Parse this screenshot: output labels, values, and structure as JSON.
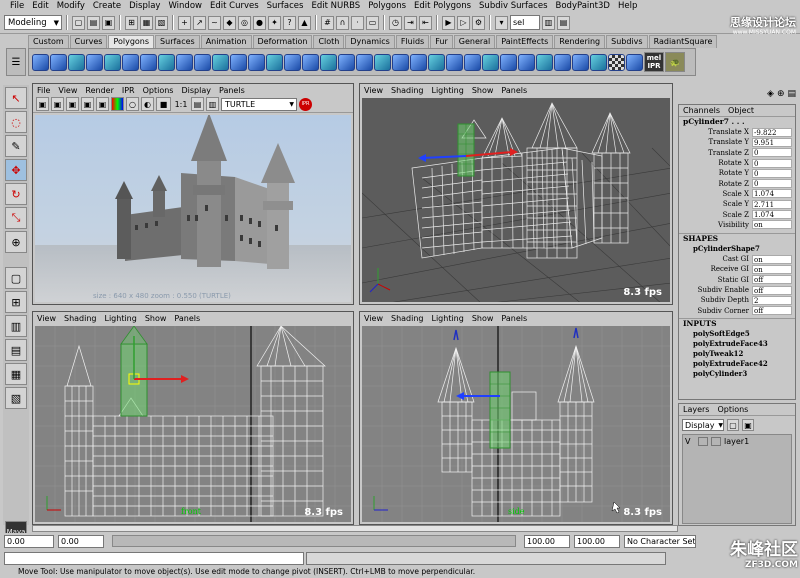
{
  "menubar": [
    "File",
    "Edit",
    "Modify",
    "Create",
    "Display",
    "Window",
    "Edit Curves",
    "Surfaces",
    "Edit NURBS",
    "Polygons",
    "Edit Polygons",
    "Subdiv Surfaces",
    "BodyPaint3D",
    "Help"
  ],
  "statusline": {
    "mode": "Modeling",
    "sel": "sel"
  },
  "shelf_tabs": [
    "Custom",
    "Curves",
    "Polygons",
    "Surfaces",
    "Animation",
    "Deformation",
    "Cloth",
    "Dynamics",
    "Fluids",
    "Fur",
    "General",
    "PaintEffects",
    "Rendering",
    "Subdivs",
    "RadiantSquare"
  ],
  "shelf_active": "Polygons",
  "shelf_mel": "mel",
  "shelf_ipr": "IPR",
  "render_view": {
    "menu": [
      "File",
      "View",
      "Render",
      "IPR",
      "Options",
      "Display",
      "Panels"
    ],
    "ratio": "1:1",
    "renderer": "TURTLE",
    "ipr_badge": "IPR",
    "caption": "size : 640 x 480  zoom : 0.550   (TURTLE)"
  },
  "persp_view": {
    "menu": [
      "View",
      "Shading",
      "Lighting",
      "Show",
      "Panels"
    ],
    "fps": "8.3 fps"
  },
  "front_view": {
    "menu": [
      "View",
      "Shading",
      "Lighting",
      "Show",
      "Panels"
    ],
    "fps": "8.3 fps",
    "label": "front"
  },
  "side_view": {
    "menu": [
      "View",
      "Shading",
      "Lighting",
      "Show",
      "Panels"
    ],
    "fps": "8.3 fps",
    "label": "side"
  },
  "channel_box": {
    "tabs": [
      "Channels",
      "Object"
    ],
    "object": "pCylinder7 . . .",
    "attrs": [
      {
        "label": "Translate X",
        "value": "-9.822"
      },
      {
        "label": "Translate Y",
        "value": "9.951"
      },
      {
        "label": "Translate Z",
        "value": "0"
      },
      {
        "label": "Rotate X",
        "value": "0"
      },
      {
        "label": "Rotate Y",
        "value": "0"
      },
      {
        "label": "Rotate Z",
        "value": "0"
      },
      {
        "label": "Scale X",
        "value": "1.074"
      },
      {
        "label": "Scale Y",
        "value": "2.711"
      },
      {
        "label": "Scale Z",
        "value": "1.074"
      },
      {
        "label": "Visibility",
        "value": "on"
      }
    ],
    "shapes_header": "SHAPES",
    "shape_name": "pCylinderShape7",
    "shape_attrs": [
      {
        "label": "Cast GI",
        "value": "on"
      },
      {
        "label": "Receive GI",
        "value": "on"
      },
      {
        "label": "Static GI",
        "value": "off"
      },
      {
        "label": "Subdiv Enable",
        "value": "off"
      },
      {
        "label": "Subdiv Depth",
        "value": "2"
      },
      {
        "label": "Subdiv Corner",
        "value": "off"
      }
    ],
    "inputs_header": "INPUTS",
    "inputs": [
      "polySoftEdge5",
      "polyExtrudeFace43",
      "polyTweak12",
      "polyExtrudeFace42",
      "polyCylinder3"
    ]
  },
  "layers": {
    "tabs": [
      "Layers",
      "Options"
    ],
    "display": "Display",
    "layer": {
      "v": "V",
      "name": "layer1"
    }
  },
  "range": {
    "start": "0.00",
    "inner_start": "0.00",
    "inner_end": "100.00",
    "end": "100.00",
    "char_set": "No Character Set"
  },
  "help_line": "Move Tool: Use manipulator to move object(s). Use edit mode to change pivot (INSERT). Ctrl+LMB to move perpendicular.",
  "watermark_top": "思缘设计论坛",
  "watermark_top_url": "www.MISSYUAN.COM",
  "watermark_bottom": "朱峰社区",
  "watermark_bottom_url": "ZF3D.COM",
  "logo_text": "Maya"
}
